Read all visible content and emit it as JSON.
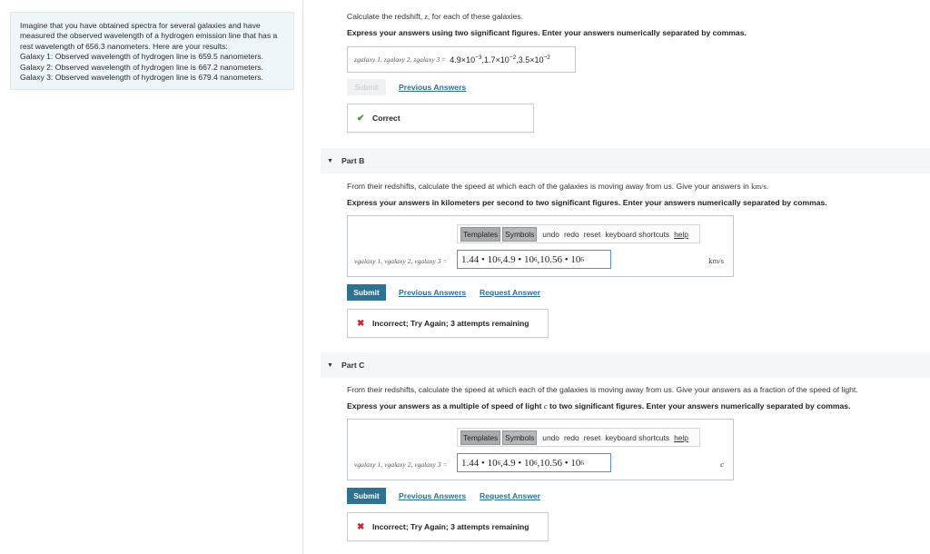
{
  "problem": {
    "text": "Imagine that you have obtained spectra for several galaxies and have measured the observed wavelength of a hydrogen emission line that has a rest wavelength of 656.3 nanometers. Here are your results:",
    "lines": [
      "Galaxy 1: Observed wavelength of hydrogen line is 659.5 nanometers.",
      "Galaxy 2: Observed wavelength of hydrogen line is 667.2 nanometers.",
      "Galaxy 3: Observed wavelength of hydrogen line is 679.4 nanometers."
    ]
  },
  "part_a": {
    "prompt_pre": "Calculate the redshift, ",
    "prompt_var": "z",
    "prompt_post": ", for each of these galaxies.",
    "instruction": "Express your answers using two significant figures. Enter your answers numerically separated by commas.",
    "vars_label": "zgalaxy 1, zgalaxy 2, zgalaxy 3 =",
    "answer": {
      "m1": "4.9×10",
      "e1": "−3",
      "m2": ",1.7×10",
      "e2": "−2",
      "m3": ",3.5×10",
      "e3": "−2"
    },
    "submit_label": "Submit",
    "previous_answers": "Previous Answers",
    "feedback": "Correct"
  },
  "part_b": {
    "title": "Part B",
    "prompt_pre": "From their redshifts, calculate the speed at which each of the galaxies is moving away from us. Give your answers in ",
    "prompt_unit": "km/s",
    "prompt_post": ".",
    "instruction": "Express your answers in kilometers per second to two significant figures. Enter your answers numerically separated by commas.",
    "toolbar": {
      "templates": "Templates",
      "symbols": "Symbols",
      "undo": "undo",
      "redo": "redo",
      "reset": "reset",
      "shortcuts": "keyboard shortcuts",
      "help": "help"
    },
    "vars_label": "vgalaxy 1, vgalaxy 2, vgalaxy 3 =",
    "math": {
      "a": "1.44 • 10",
      "ae": "6",
      "b": ",4.9 • 10",
      "be": "6",
      "c": ",10.56 • 10",
      "ce": "6"
    },
    "unit": "km/s",
    "submit_label": "Submit",
    "previous_answers": "Previous Answers",
    "request_answer": "Request Answer",
    "feedback": "Incorrect; Try Again; 3 attempts remaining"
  },
  "part_c": {
    "title": "Part C",
    "prompt": "From their redshifts, calculate the speed at which each of the galaxies is moving away from us. Give your answers as a fraction of the speed of light.",
    "instruction_pre": "Express your answers as a multiple of speed of light ",
    "instruction_var": "c",
    "instruction_post": " to two significant figures. Enter your answers numerically separated by commas.",
    "toolbar": {
      "templates": "Templates",
      "symbols": "Symbols",
      "undo": "undo",
      "redo": "redo",
      "reset": "reset",
      "shortcuts": "keyboard shortcuts",
      "help": "help"
    },
    "vars_label": "vgalaxy 1, vgalaxy 2, vgalaxy 3 =",
    "math": {
      "a": "1.44 • 10",
      "ae": "6",
      "b": ",4.9 • 10",
      "be": "6",
      "c": ",10.56 • 10",
      "ce": "6"
    },
    "unit": "c",
    "submit_label": "Submit",
    "previous_answers": "Previous Answers",
    "request_answer": "Request Answer",
    "feedback": "Incorrect; Try Again; 3 attempts remaining"
  },
  "colors": {
    "submit": "#2e7191",
    "link": "#2a6ea0",
    "correct": "#3a9a3a",
    "incorrect": "#d02626",
    "problem_bg": "#eef6fa"
  }
}
